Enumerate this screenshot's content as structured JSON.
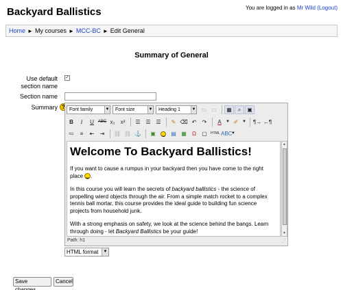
{
  "site": {
    "title": "Backyard Ballistics"
  },
  "login": {
    "prefix": "You are logged in as",
    "user": "Mr Wild",
    "logout": "(Logout)"
  },
  "breadcrumb": {
    "home": "Home",
    "my_courses": "My courses",
    "course": "MCC-BC",
    "current": "Edit General",
    "separator": "►"
  },
  "page": {
    "heading": "Summary of General"
  },
  "form": {
    "use_default_label": "Use default section name",
    "use_default_checked": true,
    "section_name_label": "Section name",
    "section_name_value": "",
    "summary_label": "Summary",
    "help_icon": "?"
  },
  "editor": {
    "font_family": "Font family",
    "font_size": "Font size",
    "format": "Heading 1",
    "content": {
      "heading": "Welcome To Backyard Ballistics!",
      "p1": "If you want to cause a rumpus in your backyard then you have come to the right place",
      "p2a": "In this course you will learn the secrets of ",
      "p2em": "backyard ballistics",
      "p2b": " - the science of propelling wierd objects through the air. From a simple match rocket to a complex tennis ball mortar, this course provides the ideal guide to building fun science projects from household junk.",
      "p3a": "With a strong emphasis on safety, we look at the science behind the bangs. Learn through doing - let ",
      "p3em": "Backyard Ballistics",
      "p3b": " be your guide!"
    },
    "path": "Path: h1"
  },
  "format_select": {
    "value": "HTML format"
  },
  "buttons": {
    "save": "Save changes",
    "cancel": "Cancel"
  }
}
